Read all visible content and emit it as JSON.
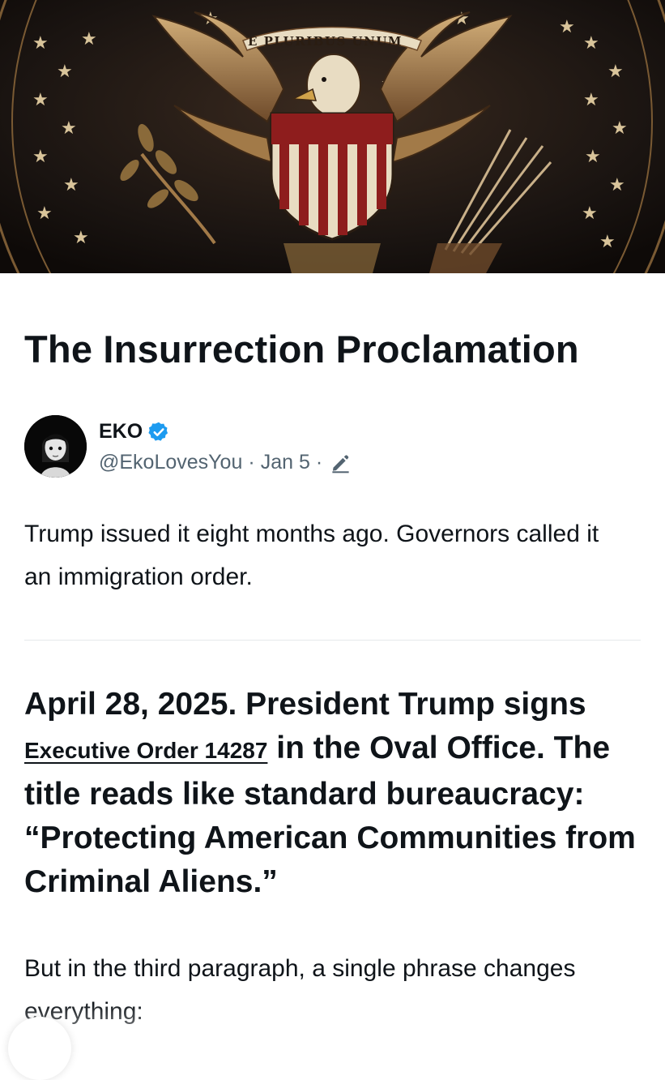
{
  "banner": {
    "motto": "E PLURIBUS UNUM",
    "colors": {
      "background": "#1a1411",
      "bronze": "#b98f52",
      "red": "#8e1d1d",
      "cream": "#e8dcc2"
    }
  },
  "article": {
    "title": "The Insurrection Proclamation",
    "author": {
      "name": "EKO",
      "handle": "@EkoLovesYou",
      "date": "Jan 5",
      "separator": "·",
      "verified_icon": "verified-badge-icon",
      "edit_icon": "edit-pencil-icon"
    },
    "intro": "Trump issued it eight months ago. Governors called it an immigration order.",
    "heading": {
      "before_link": "April 28, 2025. President Trump signs ",
      "link_text": "Executive Order 14287",
      "after_link": " in the Oval Office. The title reads like standard bureaucracy: “Protecting American Communities from Criminal Aliens.”"
    },
    "paragraph": "But in the third paragraph, a single phrase changes everything:"
  },
  "colors": {
    "text": "#0f1419",
    "muted": "#536471",
    "verified": "#1d9bf0",
    "divider": "#e6e9eb"
  }
}
